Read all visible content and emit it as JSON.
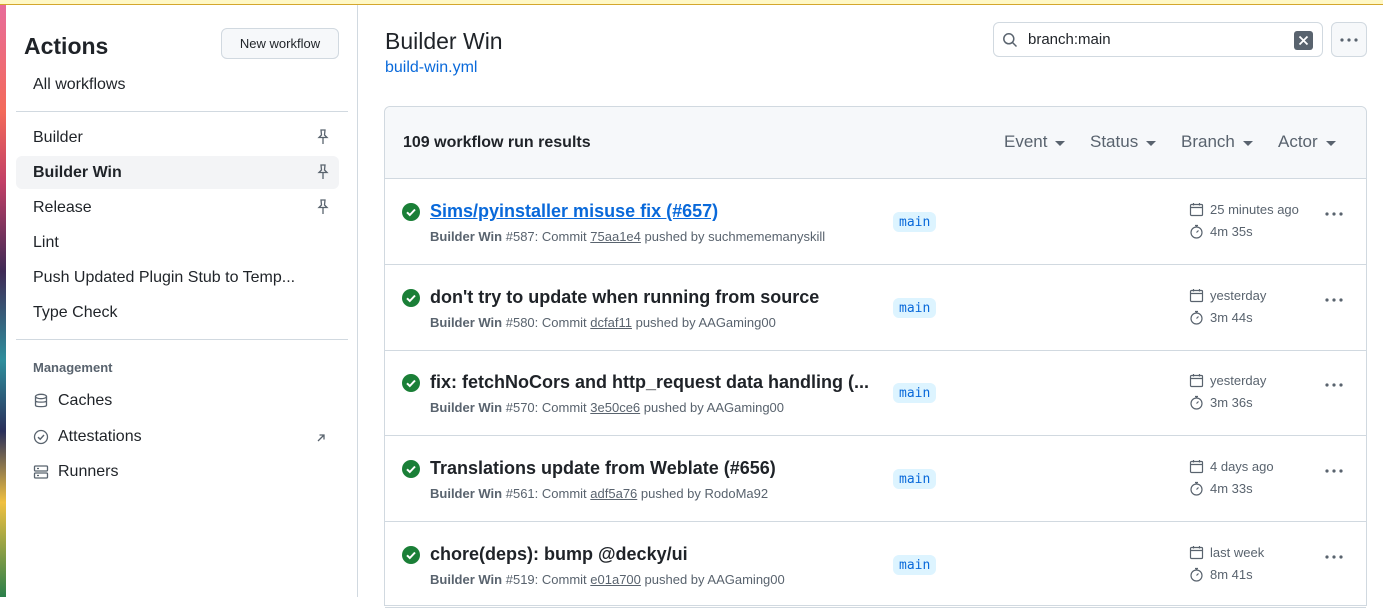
{
  "sidebar": {
    "title": "Actions",
    "new_workflow": "New workflow",
    "all_workflows": "All workflows",
    "workflows": [
      {
        "label": "Builder",
        "pinned": true
      },
      {
        "label": "Builder Win",
        "pinned": true,
        "active": true
      },
      {
        "label": "Release",
        "pinned": true
      },
      {
        "label": "Lint"
      },
      {
        "label": "Push Updated Plugin Stub to Temp..."
      },
      {
        "label": "Type Check"
      }
    ],
    "management_heading": "Management",
    "management": [
      {
        "label": "Caches",
        "icon": "database-icon"
      },
      {
        "label": "Attestations",
        "icon": "verified-icon"
      },
      {
        "label": "Runners",
        "icon": "server-icon"
      }
    ]
  },
  "main": {
    "title": "Builder Win",
    "file": "build-win.yml",
    "search_value": "branch:main",
    "results": "109 workflow run results",
    "filters": [
      "Event",
      "Status",
      "Branch",
      "Actor"
    ]
  },
  "runs": [
    {
      "title": "Sims/pyinstaller misuse fix (#657)",
      "workflow": "Builder Win",
      "run": "#587: Commit",
      "sha": "75aa1e4",
      "pushed": "pushed by suchmememanyskill",
      "branch": "main",
      "when": "25 minutes ago",
      "duration": "4m 35s"
    },
    {
      "title": "don't try to update when running from source",
      "workflow": "Builder Win",
      "run": "#580: Commit",
      "sha": "dcfaf11",
      "pushed": "pushed by AAGaming00",
      "branch": "main",
      "when": "yesterday",
      "duration": "3m 44s"
    },
    {
      "title": "fix: fetchNoCors and http_request data handling (...",
      "workflow": "Builder Win",
      "run": "#570: Commit",
      "sha": "3e50ce6",
      "pushed": "pushed by AAGaming00",
      "branch": "main",
      "when": "yesterday",
      "duration": "3m 36s"
    },
    {
      "title": "Translations update from Weblate (#656)",
      "workflow": "Builder Win",
      "run": "#561: Commit",
      "sha": "adf5a76",
      "pushed": "pushed by RodoMa92",
      "branch": "main",
      "when": "4 days ago",
      "duration": "4m 33s"
    },
    {
      "title": "chore(deps): bump @decky/ui",
      "workflow": "Builder Win",
      "run": "#519: Commit",
      "sha": "e01a700",
      "pushed": "pushed by AAGaming00",
      "branch": "main",
      "when": "last week",
      "duration": "8m 41s"
    }
  ],
  "colors": {
    "success": "#1a7f37",
    "link": "#0969da",
    "accent": "#0969da",
    "banner": "#fff8c5"
  }
}
